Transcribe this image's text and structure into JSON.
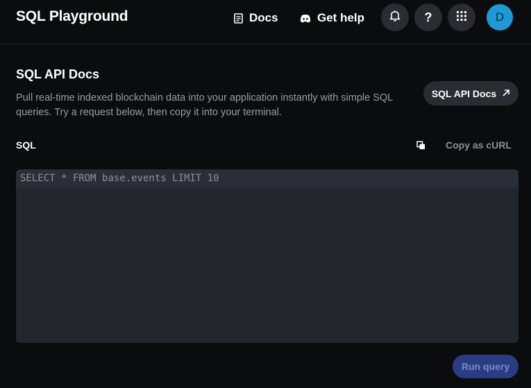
{
  "header": {
    "title": "SQL Playground",
    "docs_label": "Docs",
    "help_label": "Get help",
    "help_glyph": "?",
    "avatar_initial": "D",
    "icons": [
      "doc-icon",
      "discord-icon",
      "bell-icon",
      "question-icon",
      "grid-icon"
    ]
  },
  "main": {
    "title": "SQL API Docs",
    "description": "Pull real-time indexed blockchain data into your application instantly with simple SQL queries. Try a request below, then copy it into your terminal.",
    "docs_button": "SQL API Docs",
    "docs_button_icon": "external-link-icon",
    "sql_label": "SQL",
    "copy_label": "Copy as cURL",
    "copy_icon": "copy-icon",
    "query": "SELECT * FROM base.events LIMIT 10",
    "run_label": "Run query"
  },
  "colors": {
    "background": "#0b0c0e",
    "surface": "#2a2c33",
    "editor": "#24262d",
    "avatar": "#1d9ad6",
    "run_button": "#2a3c84"
  }
}
